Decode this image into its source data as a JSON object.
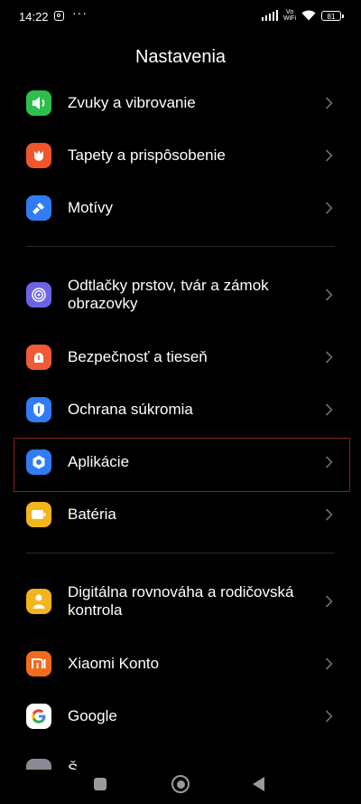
{
  "status_bar": {
    "time": "14:22",
    "dots": "···",
    "vowifi": "Vo\nWiFi",
    "battery": "81"
  },
  "page": {
    "title": "Nastavenia"
  },
  "settings": [
    {
      "label": "Zvuky a vibrovanie",
      "icon": "speaker-icon",
      "color": "#2dbe4e"
    },
    {
      "label": "Tapety a prispôsobenie",
      "icon": "tulip-icon",
      "color": "#f0562c"
    },
    {
      "label": "Motívy",
      "icon": "brush-icon",
      "color": "#2f7cf6"
    },
    {
      "label": "Odtlačky prstov, tvár a zámok obrazovky",
      "icon": "fingerprint-icon",
      "color": "#6c63e8"
    },
    {
      "label": "Bezpečnosť a tieseň",
      "icon": "sos-icon",
      "color": "#f05a36"
    },
    {
      "label": "Ochrana súkromia",
      "icon": "privacy-shield-icon",
      "color": "#2f7cf6"
    },
    {
      "label": "Aplikácie",
      "icon": "apps-gear-icon",
      "color": "#2f7cf6"
    },
    {
      "label": "Batéria",
      "icon": "battery-icon",
      "color": "#f3b41c"
    },
    {
      "label": "Digitálna rovnováha a rodičovská kontrola",
      "icon": "person-icon",
      "color": "#f3b41c"
    },
    {
      "label": "Xiaomi Konto",
      "icon": "mi-logo-icon",
      "color": "#f26b1d"
    },
    {
      "label": "Google",
      "icon": "google-g-icon",
      "color": "#ffffff"
    }
  ],
  "partial_item_label": "Š",
  "navigation": {
    "recents": "recents",
    "home": "home",
    "back": "back"
  }
}
